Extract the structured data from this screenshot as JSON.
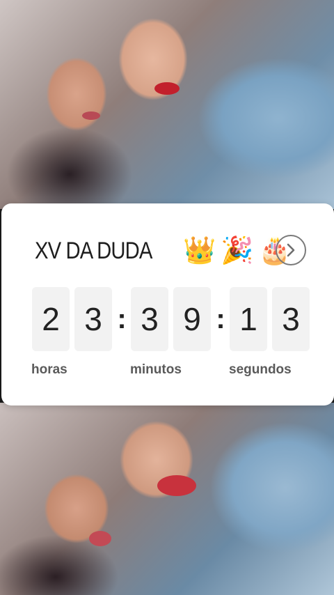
{
  "countdown": {
    "title": "XV DA DUDA",
    "emojis": [
      "👑",
      "🎉",
      "🎂"
    ],
    "digits": {
      "hours": [
        "2",
        "3"
      ],
      "minutes": [
        "3",
        "9"
      ],
      "seconds": [
        "1",
        "3"
      ]
    },
    "separator": ":",
    "labels": {
      "hours": "horas",
      "minutes": "minutos",
      "seconds": "segundos"
    },
    "open_icon": "chevron-right-circle-icon"
  },
  "colors": {
    "card_bg": "#ffffff",
    "digit_bg": "#f2f2f2",
    "text": "#1e1e1e",
    "label": "#5a5a5a"
  }
}
